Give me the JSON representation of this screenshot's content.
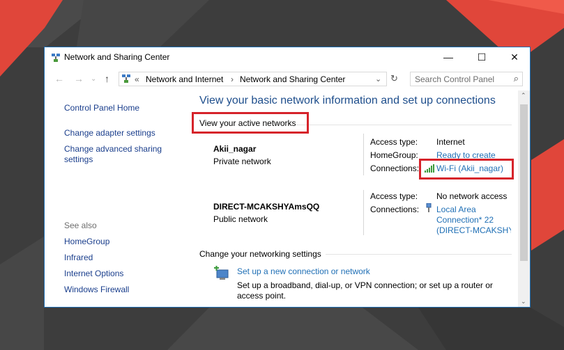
{
  "window": {
    "title": "Network and Sharing Center",
    "controls": {
      "minimize": "—",
      "maximize": "☐",
      "close": "✕"
    }
  },
  "address": {
    "crumb_prefix": "«",
    "crumb1": "Network and Internet",
    "crumb_sep": "›",
    "crumb2": "Network and Sharing Center",
    "search_placeholder": "Search Control Panel"
  },
  "sidebar": {
    "home": "Control Panel Home",
    "adapter": "Change adapter settings",
    "advanced_line1": "Change advanced sharing",
    "advanced_line2": "settings",
    "see_also": "See also",
    "homegroup": "HomeGroup",
    "infrared": "Infrared",
    "internet_options": "Internet Options",
    "firewall": "Windows Firewall"
  },
  "main": {
    "title": "View your basic network information and set up connections",
    "active_networks_heading": "View your active networks",
    "networks": [
      {
        "name": "Akii_nagar",
        "type": "Private network",
        "access_type_label": "Access type:",
        "access_type_value": "Internet",
        "homegroup_label": "HomeGroup:",
        "homegroup_value": "Ready to create",
        "connections_label": "Connections:",
        "connections_value": "Wi-Fi (Akii_nagar)"
      },
      {
        "name": "DIRECT-MCAKSHYAmsQQ",
        "type": "Public network",
        "access_type_label": "Access type:",
        "access_type_value": "No network access",
        "connections_label": "Connections:",
        "connections_value_line1": "Local Area",
        "connections_value_line2": "Connection* 22",
        "connections_value_line3": "(DIRECT-MCAKSHY/"
      }
    ],
    "change_settings_heading": "Change your networking settings",
    "setup_link": "Set up a new connection or network",
    "setup_desc_line1": "Set up a broadband, dial-up, or VPN connection; or set up a router or",
    "setup_desc_line2": "access point."
  },
  "colors": {
    "highlight_red": "#d6232a",
    "link_blue": "#1f6fb5",
    "title_blue": "#1e4e8c",
    "background_red": "#e0463a"
  }
}
